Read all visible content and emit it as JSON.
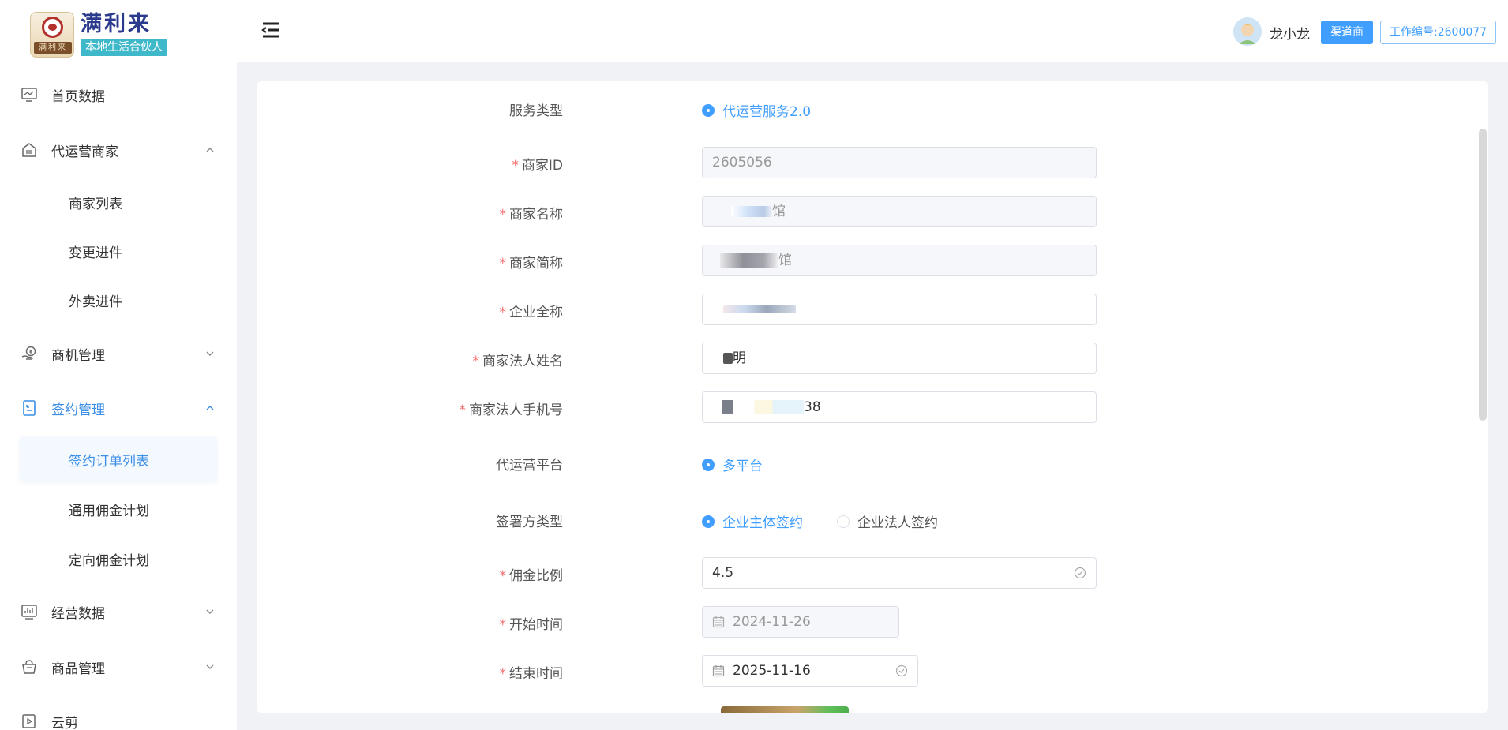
{
  "app": {
    "logo_title": "满利来",
    "logo_subtitle": "本地生活合伙人",
    "logo_script": "满利来"
  },
  "sidebar": {
    "items": [
      {
        "label": "首页数据",
        "icon": "monitor-icon"
      },
      {
        "label": "代运营商家",
        "icon": "house-icon",
        "expanded": true
      },
      {
        "label": "商机管理",
        "icon": "money-hand-icon",
        "expanded": false
      },
      {
        "label": "签约管理",
        "icon": "contract-icon",
        "expanded": true,
        "active": true
      },
      {
        "label": "经营数据",
        "icon": "chart-icon",
        "expanded": false
      },
      {
        "label": "商品管理",
        "icon": "basket-icon",
        "expanded": false
      },
      {
        "label": "云剪",
        "icon": "video-icon"
      }
    ],
    "merchant_sub": [
      "商家列表",
      "变更进件",
      "外卖进件"
    ],
    "contract_sub": [
      "签约订单列表",
      "通用佣金计划",
      "定向佣金计划"
    ]
  },
  "header": {
    "user_name": "龙小龙",
    "role": "渠道商",
    "work_no": "工作编号:2600077"
  },
  "form": {
    "service_type": {
      "label": "服务类型",
      "option": "代运营服务2.0"
    },
    "merchant_id": {
      "label": "商家ID",
      "value": "2605056"
    },
    "merchant_name": {
      "label": "商家名称",
      "visible_suffix": "馆"
    },
    "merchant_short": {
      "label": "商家简称",
      "visible_suffix": "馆"
    },
    "company_name": {
      "label": "企业全称"
    },
    "legal_name": {
      "label": "商家法人姓名",
      "visible_suffix": "明"
    },
    "legal_phone": {
      "label": "商家法人手机号",
      "visible_suffix": "38"
    },
    "platform": {
      "label": "代运营平台",
      "option": "多平台"
    },
    "signer_type": {
      "label": "签署方类型",
      "options": [
        "企业主体签约",
        "企业法人签约"
      ],
      "selected": 0
    },
    "commission": {
      "label": "佣金比例",
      "value": "4.5"
    },
    "start_time": {
      "label": "开始时间",
      "value": "2024-11-26"
    },
    "end_time": {
      "label": "结束时间",
      "value": "2025-11-16"
    }
  },
  "colors": {
    "accent": "#409eff",
    "required": "#f56c6c",
    "sidebar_bg": "#ffffff",
    "page_bg": "#f0f2f5"
  }
}
